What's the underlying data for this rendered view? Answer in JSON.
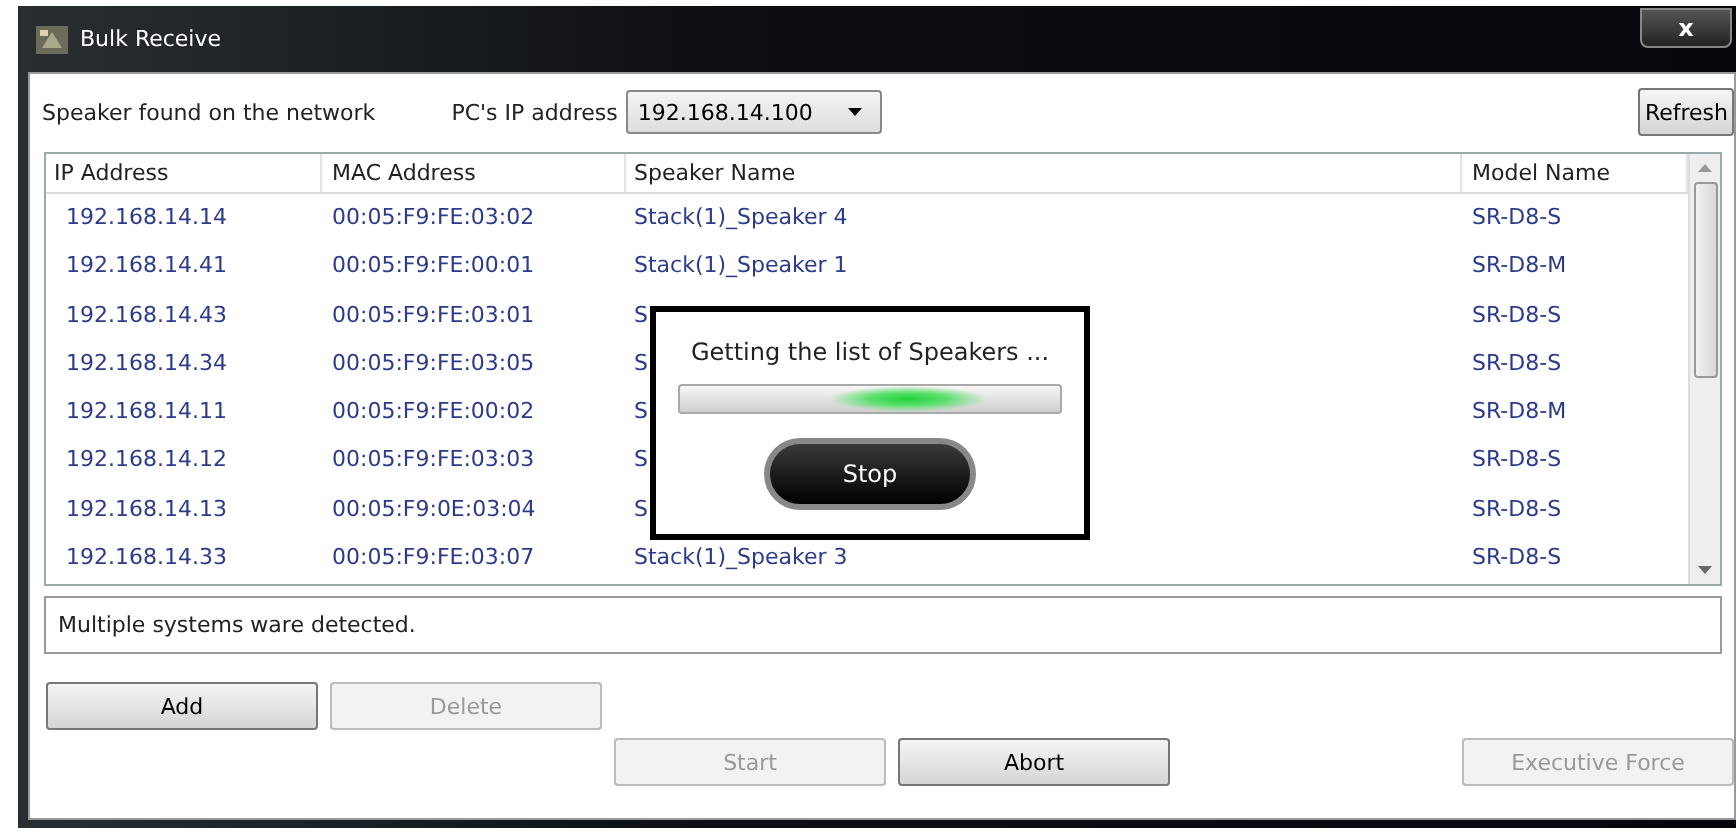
{
  "window": {
    "title": "Bulk Receive",
    "close": "x"
  },
  "toolbar": {
    "label": "Speaker found on the network",
    "ip_label": "PC's IP address",
    "ip_value": "192.168.14.100",
    "refresh": "Refresh"
  },
  "table": {
    "columns": [
      "IP Address",
      "MAC Address",
      "Speaker Name",
      "Model Name"
    ],
    "rows": [
      {
        "ip": "192.168.14.14",
        "mac": "00:05:F9:FE:03:02",
        "speaker": "Stack(1)_Speaker 4",
        "model": "SR-D8-S"
      },
      {
        "ip": "192.168.14.41",
        "mac": "00:05:F9:FE:00:01",
        "speaker": "Stack(1)_Speaker 1",
        "model": "SR-D8-M"
      },
      {
        "ip": "192.168.14.43",
        "mac": "00:05:F9:FE:03:01",
        "speaker": "S",
        "model": "SR-D8-S"
      },
      {
        "ip": "192.168.14.34",
        "mac": "00:05:F9:FE:03:05",
        "speaker": "S",
        "model": "SR-D8-S"
      },
      {
        "ip": "192.168.14.11",
        "mac": "00:05:F9:FE:00:02",
        "speaker": "S",
        "model": "SR-D8-M"
      },
      {
        "ip": "192.168.14.12",
        "mac": "00:05:F9:FE:03:03",
        "speaker": "S",
        "model": "SR-D8-S"
      },
      {
        "ip": "192.168.14.13",
        "mac": "00:05:F9:0E:03:04",
        "speaker": "S",
        "model": "SR-D8-S"
      },
      {
        "ip": "192.168.14.33",
        "mac": "00:05:F9:FE:03:07",
        "speaker": "Stack(1)_Speaker 3",
        "model": "SR-D8-S"
      }
    ]
  },
  "message": "Multiple systems ware detected.",
  "edit_buttons": [
    {
      "label": "Add",
      "disabled": false
    },
    {
      "label": "Delete",
      "disabled": true
    }
  ],
  "action_buttons": [
    {
      "label": "Start",
      "disabled": true
    },
    {
      "label": "Abort",
      "disabled": false
    },
    {
      "label": "Executive Force",
      "disabled": true
    }
  ],
  "dialog": {
    "text": "Getting the list of Speakers ...",
    "level": 0.6,
    "button": "Stop"
  }
}
